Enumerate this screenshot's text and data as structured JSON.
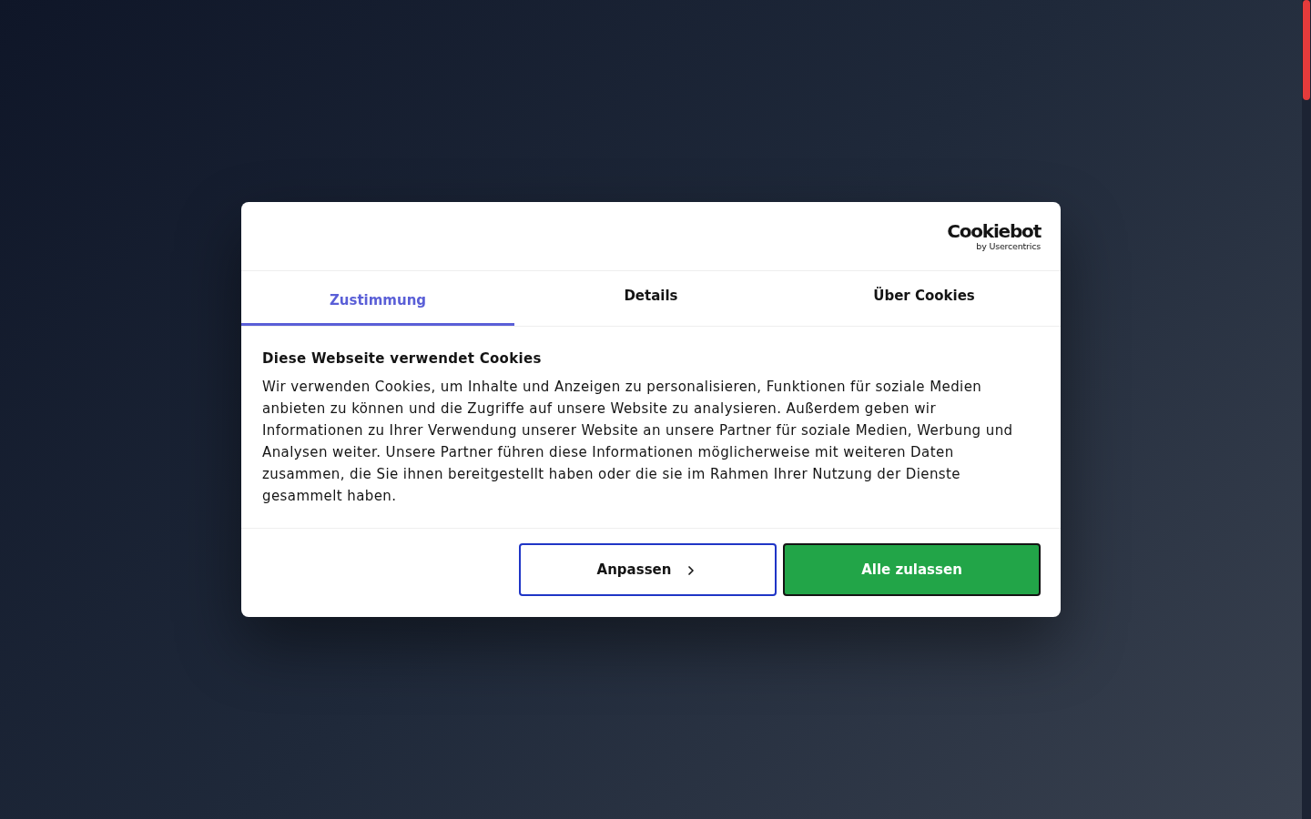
{
  "logo": {
    "wordmark": "Cookiebot",
    "byline": "by Usercentrics"
  },
  "tabs": [
    {
      "label": "Zustimmung",
      "selected": true
    },
    {
      "label": "Details",
      "selected": false
    },
    {
      "label": "Über Cookies",
      "selected": false
    }
  ],
  "content": {
    "title": "Diese Webseite verwendet Cookies",
    "text": "Wir verwenden Cookies, um Inhalte und Anzeigen zu personalisieren, Funktionen für soziale Medien anbieten zu können und die Zugriffe auf unsere Website zu analysieren. Außerdem geben wir Informationen zu Ihrer Verwendung unserer Website an unsere Partner für soziale Medien, Werbung und Analysen weiter. Unsere Partner führen diese Informationen möglicherweise mit weiteren Daten zusammen, die Sie ihnen bereitgestellt haben oder die sie im Rahmen Ihrer Nutzung der Dienste gesammelt haben."
  },
  "buttons": [
    {
      "label": "Anpassen",
      "kind": "secondary"
    },
    {
      "label": "Alle zulassen",
      "kind": "primary"
    }
  ]
}
